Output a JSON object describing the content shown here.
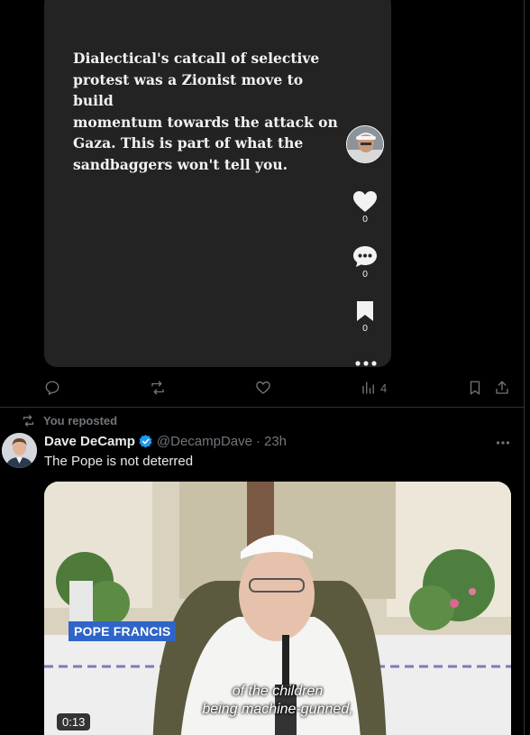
{
  "embedded_card": {
    "text": "Dialectical's catcall of selective\nprotest was a Zionist move to build\nmomentum towards the attack on\nGaza.  This is part of what the\nsandbaggers won't tell you.",
    "like_count": "0",
    "comment_count": "0",
    "bookmark_count": "0"
  },
  "prev_post_actions": {
    "view_count": "4"
  },
  "repost": {
    "label": "You reposted"
  },
  "post": {
    "display_name": "Dave DeCamp",
    "handle": "@DecampDave",
    "dot": "·",
    "time": "23h",
    "text": "The Pope is not deterred"
  },
  "video": {
    "name_tag": "POPE FRANCIS",
    "caption": "of the children\nbeing machine-gunned,",
    "duration": "0:13"
  },
  "colors": {
    "background": "#000000",
    "card": "#232323",
    "muted": "#71767b",
    "verified": "#1d9bf0",
    "name_tag": "#2f64c9"
  }
}
